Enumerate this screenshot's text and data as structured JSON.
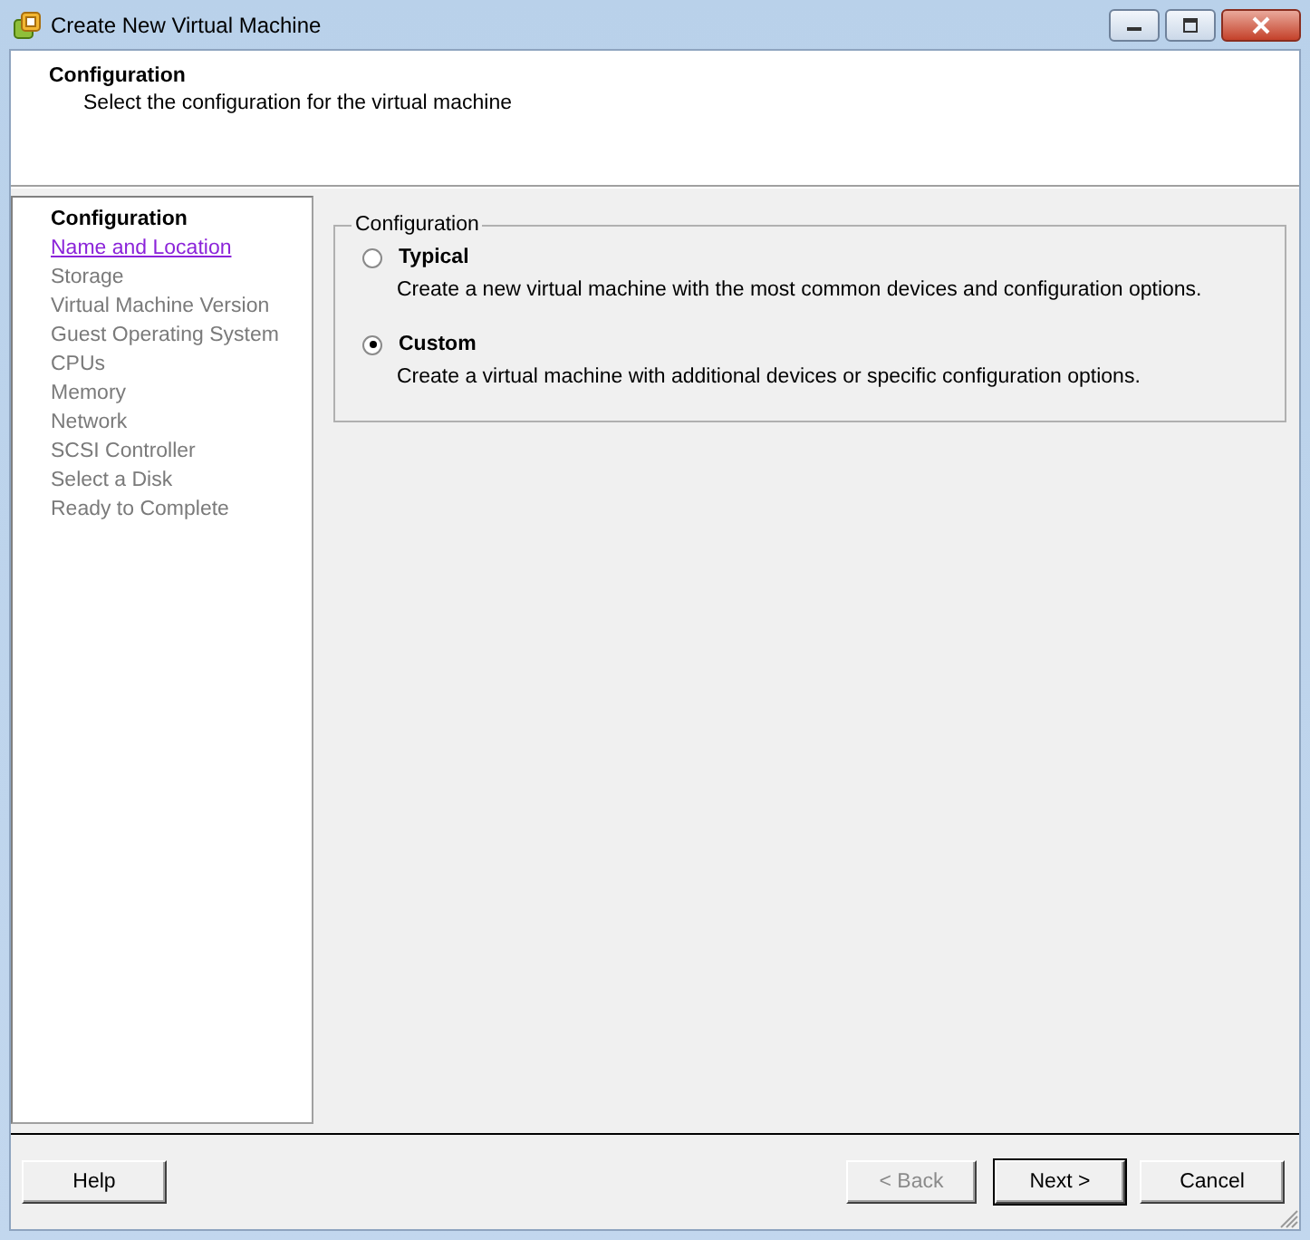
{
  "window": {
    "title": "Create New Virtual Machine"
  },
  "header": {
    "title": "Configuration",
    "subtitle": "Select the configuration for the virtual machine"
  },
  "steps": [
    {
      "label": "Configuration",
      "kind": "current"
    },
    {
      "label": "Name and Location",
      "kind": "link"
    },
    {
      "label": "Storage",
      "kind": "pending"
    },
    {
      "label": "Virtual Machine Version",
      "kind": "pending"
    },
    {
      "label": "Guest Operating System",
      "kind": "pending"
    },
    {
      "label": "CPUs",
      "kind": "pending"
    },
    {
      "label": "Memory",
      "kind": "pending"
    },
    {
      "label": "Network",
      "kind": "pending"
    },
    {
      "label": "SCSI Controller",
      "kind": "pending"
    },
    {
      "label": "Select a Disk",
      "kind": "pending"
    },
    {
      "label": "Ready to Complete",
      "kind": "pending"
    }
  ],
  "group": {
    "title": "Configuration",
    "options": [
      {
        "label": "Typical",
        "description": "Create a new virtual machine with the most common devices and configuration options.",
        "selected": false
      },
      {
        "label": "Custom",
        "description": "Create a virtual machine with additional devices or specific configuration options.",
        "selected": true
      }
    ]
  },
  "buttons": {
    "help": {
      "label": "Help"
    },
    "nav": [
      {
        "label": "< Back",
        "disabled": true,
        "default": false
      },
      {
        "label": "Next >",
        "disabled": false,
        "default": true
      },
      {
        "label": "Cancel",
        "disabled": false,
        "default": false
      }
    ]
  }
}
